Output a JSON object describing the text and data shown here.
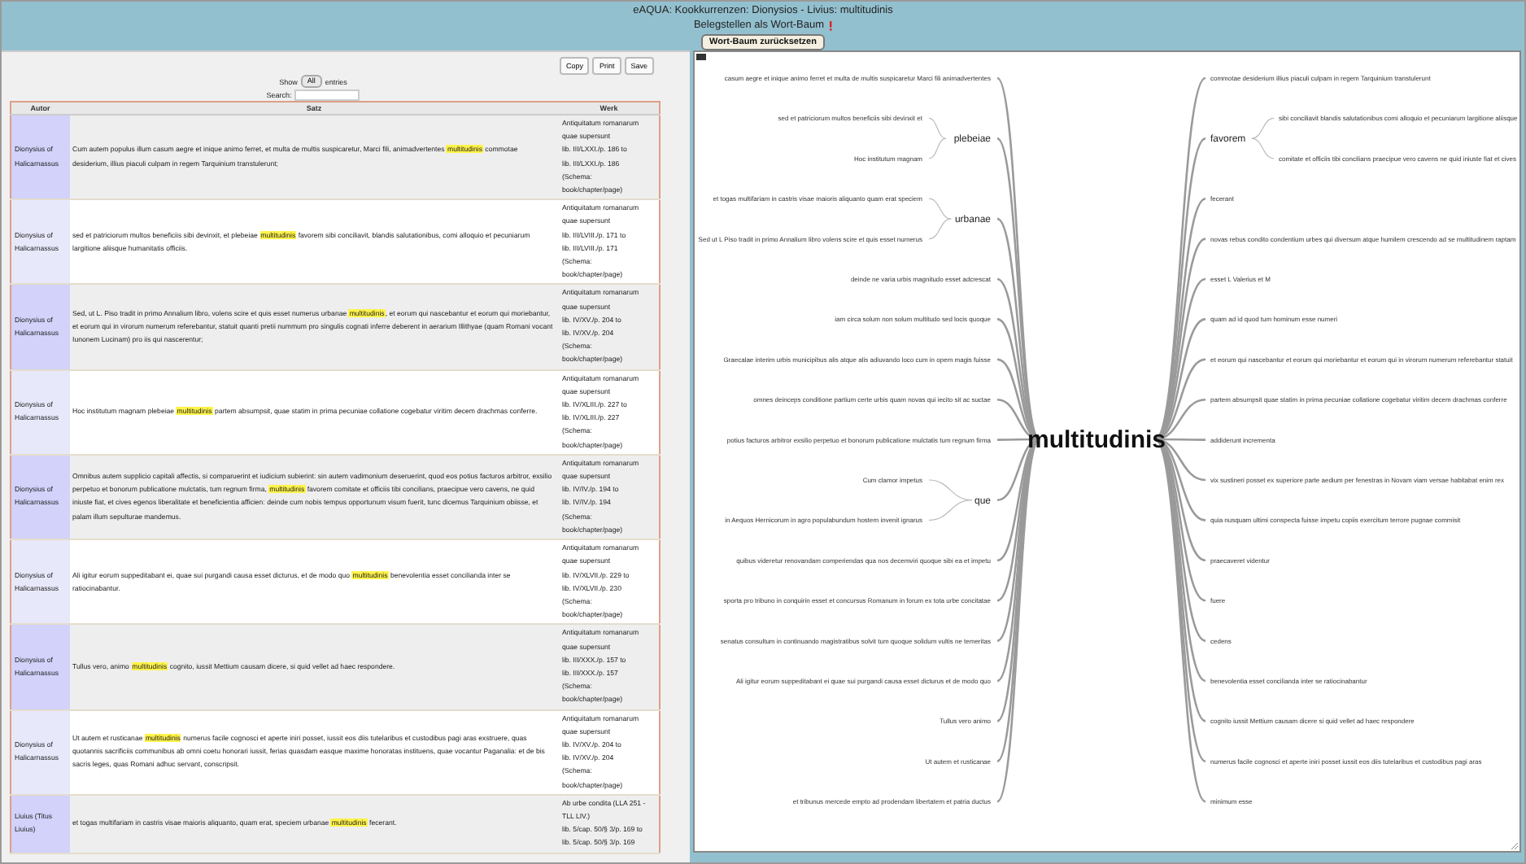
{
  "header": {
    "title": "eAQUA: Kookkurrenzen: Dionysios - Livius: multitudinis",
    "subtitle": "Belegstellen als Wort-Baum",
    "reset_button": "Wort-Baum zurücksetzen"
  },
  "toolbar": {
    "buttons": [
      "Copy",
      "Print",
      "Save"
    ],
    "show_label": "Show",
    "show_value": "All",
    "entries_label": "entries",
    "search_label": "Search:"
  },
  "table": {
    "columns": [
      "Autor",
      "Satz",
      "Werk"
    ],
    "rows": [
      {
        "autor": "Dionysius of Halicarnassus",
        "satz": "Cum autem populus illum casum aegre et inique animo ferret, et multa de multis suspicaretur, Marci fili, animadvertentes **multitudinis** commotae desiderium, illius piaculi culpam in regem Tarquinium transtulerunt;",
        "werk": [
          "Antiquitatum romanarum",
          "quae supersunt",
          "lib. III/LXXI./p. 186 to",
          "lib. III/LXXI./p. 186",
          "(Schema:",
          "book/chapter/page)"
        ]
      },
      {
        "autor": "Dionysius of Halicarnassus",
        "satz": "sed et patriciorum multos beneficiis sibi devinxit, et plebeiae **multitudinis** favorem sibi conciliavit, blandis salutationibus, comi alloquio et pecuniarum largitione aliisque humanitatis officiis.",
        "werk": [
          "Antiquitatum romanarum",
          "quae supersunt",
          "lib. III/LVIII./p. 171 to",
          "lib. III/LVIII./p. 171",
          "(Schema:",
          "book/chapter/page)"
        ]
      },
      {
        "autor": "Dionysius of Halicarnassus",
        "satz": "Sed, ut L. Piso tradit in primo Annalium libro, volens scire et quis esset numerus urbanae **multitudinis**, et eorum qui nascebantur et eorum qui moriebantur, et eorum qui in virorum numerum referebantur, statuit quanti pretii nummum pro singulis cognati inferre deberent in aerarium Illithyae (quam Romani vocant Iunonem Lucinam) pro iis qui nascerentur;",
        "werk": [
          "Antiquitatum romanarum",
          "quae supersunt",
          "lib. IV/XV./p. 204 to",
          "lib. IV/XV./p. 204",
          "(Schema:",
          "book/chapter/page)"
        ]
      },
      {
        "autor": "Dionysius of Halicarnassus",
        "satz": "Hoc institutum magnam plebeiae **multitudinis** partem absumpsit, quae statim in prima pecuniae collatione cogebatur viritim decem drachmas conferre.",
        "werk": [
          "Antiquitatum romanarum",
          "quae supersunt",
          "lib. IV/XLIII./p. 227 to",
          "lib. IV/XLIII./p. 227",
          "(Schema:",
          "book/chapter/page)"
        ]
      },
      {
        "autor": "Dionysius of Halicarnassus",
        "satz": "Omnibus autem supplicio capitali affectis, si comparuerint et iudicium subierint: sin autem vadimonium deseruerint, quod eos potius facturos arbitror, exsilio perpetuo et bonorum publicatione mulctatis, tum regnum firma, **multitudinis** favorem comitate et officiis tibi concilians, praecipue vero cavens, ne quid iniuste fiat, et cives egenos liberalitate et beneficientia afficien: deinde cum nobis tempus opportunum visum fuerit, tunc dicemus Tarquinium obiisse, et palam illum sepulturae mandemus.",
        "werk": [
          "Antiquitatum romanarum",
          "quae supersunt",
          "lib. IV/IV./p. 194 to",
          "lib. IV/IV./p. 194",
          "(Schema:",
          "book/chapter/page)"
        ]
      },
      {
        "autor": "Dionysius of Halicarnassus",
        "satz": "Ali igitur eorum suppeditabant ei, quae sui purgandi causa esset dicturus, et de modo quo **multitudinis** benevolentia esset concilianda inter se ratiocinabantur.",
        "werk": [
          "Antiquitatum romanarum",
          "quae supersunt",
          "lib. IV/XLVII./p. 229 to",
          "lib. IV/XLVII./p. 230",
          "(Schema:",
          "book/chapter/page)"
        ]
      },
      {
        "autor": "Dionysius of Halicarnassus",
        "satz": "Tullus vero, animo **multitudinis** cognito, iussit Mettium causam dicere, si quid vellet ad haec respondere.",
        "werk": [
          "Antiquitatum romanarum",
          "quae supersunt",
          "lib. III/XXX./p. 157 to",
          "lib. III/XXX./p. 157",
          "(Schema:",
          "book/chapter/page)"
        ]
      },
      {
        "autor": "Dionysius of Halicarnassus",
        "satz": "Ut autem et rusticanae **multitudinis** numerus facile cognosci et aperte iniri posset, iussit eos diis tutelaribus et custodibus pagi aras exstruere, quas quotannis sacrificiis communibus ab omni coetu honorari iussit, ferias quasdam easque maxime honoratas instituens, quae vocantur Paganalia: et de bis sacris leges, quas Romani adhuc servant, conscripsit.",
        "werk": [
          "Antiquitatum romanarum",
          "quae supersunt",
          "lib. IV/XV./p. 204 to",
          "lib. IV/XV./p. 204",
          "(Schema:",
          "book/chapter/page)"
        ]
      },
      {
        "autor": "Liuius (Titus Liuius)",
        "satz": "et togas multifariam in castris visae maioris aliquanto, quam erat, speciem urbanae **multitudinis** fecerant.",
        "werk": [
          "Ab urbe condita (LLA 251 -",
          "TLL LIV.)",
          "lib. 5/cap. 50/§ 3/p. 169 to",
          "lib. 5/cap. 50/§ 3/p. 169"
        ]
      }
    ]
  },
  "tree": {
    "root": "multitudinis",
    "left": [
      {
        "text": "casum aegre et inique animo ferret et multa de multis suspicaretur Marci fili animadvertentes"
      },
      {
        "text": "plebeiae",
        "children": [
          {
            "text": "sed et patriciorum multos beneficiis sibi devinxit et"
          },
          {
            "text": "Hoc institutum magnam"
          }
        ]
      },
      {
        "text": "urbanae",
        "children": [
          {
            "text": "et togas multifariam in castris visae maioris aliquanto quam erat speciem"
          },
          {
            "text": "Sed ut L Piso tradit in primo Annalium libro volens scire et quis esset numerus"
          }
        ]
      },
      {
        "text": "deinde ne varia urbis magnitudo esset adcrescat"
      },
      {
        "text": "iam circa solum non solum multitudo sed locis quoque"
      },
      {
        "text": "Graecalae interim urbis municipibus alis atque alis adiuvando loco cum in opem magis fuisse"
      },
      {
        "text": "omnes deinceps conditione partium certe urbis quam novas qui iecito sit ac suctae"
      },
      {
        "text": "potius facturos arbitror exsilio perpetuo et bonorum publicatione mulctatis tum regnum firma"
      },
      {
        "text": "que",
        "children": [
          {
            "text": "Cum clamor impetus"
          },
          {
            "text": "in Aequos Hernicorum in agro populabundum hostem invenit ignarus"
          }
        ]
      },
      {
        "text": "quibus videretur renovandam comperiendas qua nos decemviri quoque sibi ea et impetu"
      },
      {
        "text": "sporta pro tribuno in conquirin esset et concursus Romanum in forum ex tota urbe concitatae"
      },
      {
        "text": "senatus consultum in continuando magistratibus solvit tum quoque solidum vultis ne temeritas"
      },
      {
        "text": "Ali igitur eorum suppeditabant ei quae sui purgandi causa esset dicturus et de modo quo"
      },
      {
        "text": "Tullus vero animo"
      },
      {
        "text": "Ut autem et rusticanae"
      },
      {
        "text": "et tribunus mercede empto ad prodendam libertatem et patria ductus"
      }
    ],
    "right": [
      {
        "text": "commotae desiderium illius piaculi culpam in regem Tarquinium transtulerunt"
      },
      {
        "text": "favorem",
        "children": [
          {
            "text": "sibi conciliavit blandis salutationibus comi alloquio et pecuniarum largitione aliisque"
          },
          {
            "text": "comitate et officiis tibi concilians praecipue vero cavens ne quid iniuste fiat et cives"
          }
        ]
      },
      {
        "text": "fecerant"
      },
      {
        "text": "novas rebus condito condentium urbes qui diversum atque humilem crescendo ad se multitudinem raptam"
      },
      {
        "text": "esset L Valerius et M"
      },
      {
        "text": "quam ad id quod tum hominum esse numeri"
      },
      {
        "text": "et eorum qui nascebantur et eorum qui moriebantur et eorum qui in virorum numerum referebantur statuit"
      },
      {
        "text": "partem absumpsit quae statim in prima pecuniae collatione cogebatur viritim decem drachmas conferre"
      },
      {
        "text": "addiderunt incrementa"
      },
      {
        "text": "vix sustineri posset ex superiore parte aedium per fenestras in Novam viam versae habitabat enim rex"
      },
      {
        "text": "quia nusquam ultimi conspecta fuisse impetu copiis exercitum terrore pugnae commisit"
      },
      {
        "text": "praecaveret videntur"
      },
      {
        "text": "fuere"
      },
      {
        "text": "cedens"
      },
      {
        "text": "benevolentia esset concilianda inter se ratiocinabantur"
      },
      {
        "text": "cognito iussit Mettium causam dicere si quid vellet ad haec respondere"
      },
      {
        "text": "numerus facile cognosci et aperte iniri posset iussit eos diis tutelaribus et custodibus pagi aras"
      },
      {
        "text": "minimum esse"
      }
    ]
  }
}
